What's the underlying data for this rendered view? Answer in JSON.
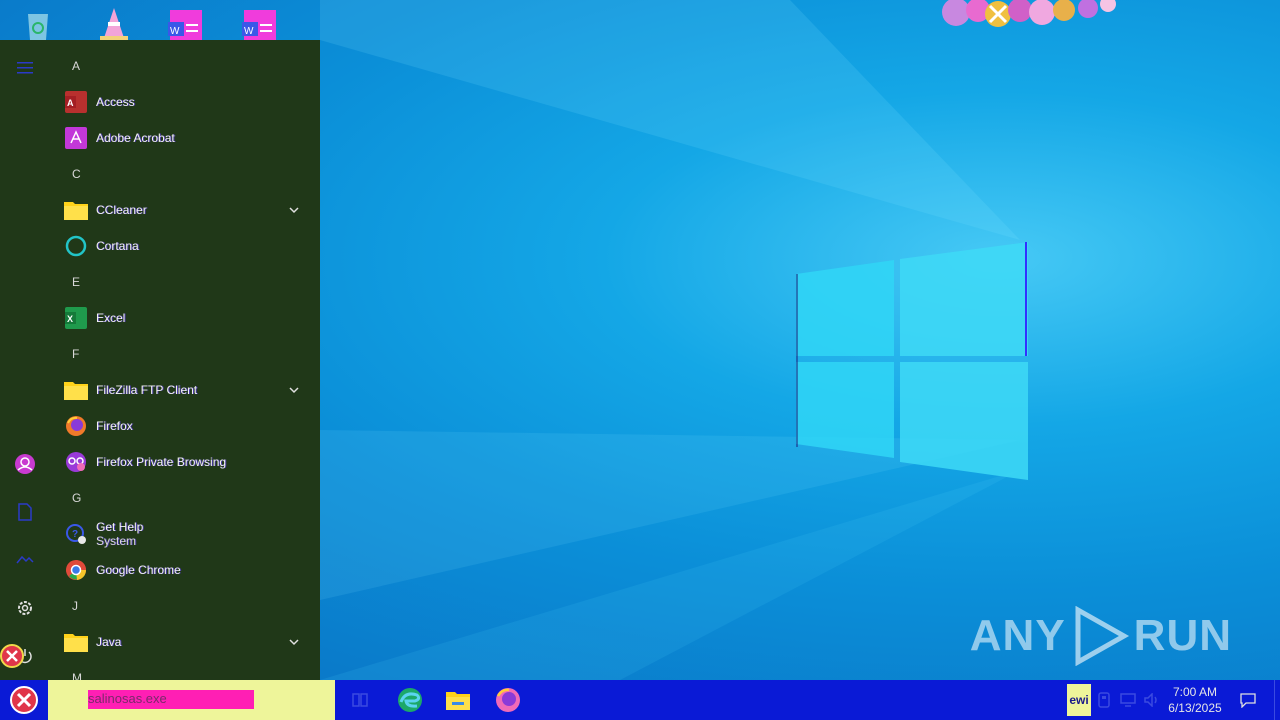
{
  "desktop": {
    "icons": [
      "recycle-bin-icon",
      "traffic-cone-icon",
      "document-icon",
      "document-icon"
    ],
    "watermark": {
      "left": "ANY",
      "right": "RUN"
    }
  },
  "start_menu": {
    "rail": [
      "hamburger-menu-icon",
      "user-icon",
      "documents-icon",
      "pictures-icon",
      "settings-icon",
      "power-icon"
    ],
    "letter_a": "A",
    "access": "Access",
    "adobe_acrobat": "Adobe Acrobat",
    "letter_c": "C",
    "ccleaner": "CCleaner",
    "cortana": "Cortana",
    "letter_e": "E",
    "excel": "Excel",
    "letter_f": "F",
    "filezilla": "FileZilla FTP Client",
    "firefox": "Firefox",
    "firefox_private": "Firefox Private Browsing",
    "letter_g": "G",
    "get_help": "Get Help",
    "get_help_sub": "System",
    "chrome": "Google Chrome",
    "letter_j": "J",
    "java": "Java",
    "letter_m": "M"
  },
  "taskbar": {
    "search_value": "salinosas.exe",
    "pinned": [
      "task-view-icon",
      "edge-icon",
      "file-explorer-icon",
      "firefox-icon"
    ],
    "language": "ewi",
    "time": "7:00 AM",
    "date": "6/13/2025"
  },
  "colors": {
    "menu_bg": "#203818",
    "taskbar_bg": "#0a1ad6",
    "search_bg": "#eef59a",
    "search_highlight": "#ff1fb4",
    "folder": "#ffd21a"
  }
}
